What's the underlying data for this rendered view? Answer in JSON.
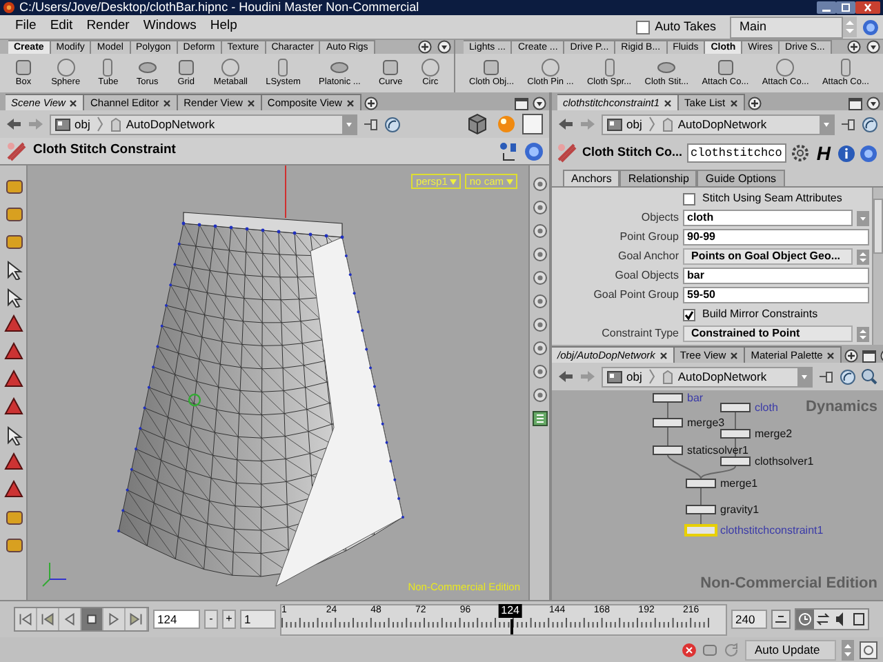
{
  "window": {
    "title": "C:/Users/Jove/Desktop/clothBar.hipnc - Houdini Master Non-Commercial"
  },
  "menu": [
    "File",
    "Edit",
    "Render",
    "Windows",
    "Help"
  ],
  "auto_takes": {
    "label": "Auto Takes",
    "checked": false
  },
  "take_menu": {
    "value": "Main"
  },
  "shelves": [
    {
      "tabs": [
        {
          "label": "Create",
          "selected": true
        },
        {
          "label": "Modify",
          "selected": false
        },
        {
          "label": "Model",
          "selected": false
        },
        {
          "label": "Polygon",
          "selected": false
        },
        {
          "label": "Deform",
          "selected": false
        },
        {
          "label": "Texture",
          "selected": false
        },
        {
          "label": "Character",
          "selected": false
        },
        {
          "label": "Auto Rigs",
          "selected": false
        }
      ],
      "tools": [
        "Box",
        "Sphere",
        "Tube",
        "Torus",
        "Grid",
        "Metaball",
        "LSystem",
        "Platonic ...",
        "Curve",
        "Circ"
      ]
    },
    {
      "tabs": [
        {
          "label": "Lights ...",
          "selected": false
        },
        {
          "label": "Create ...",
          "selected": false
        },
        {
          "label": "Drive P...",
          "selected": false
        },
        {
          "label": "Rigid B...",
          "selected": false
        },
        {
          "label": "Fluids",
          "selected": false
        },
        {
          "label": "Cloth",
          "selected": true
        },
        {
          "label": "Wires",
          "selected": false
        },
        {
          "label": "Drive S...",
          "selected": false
        }
      ],
      "tools": [
        "Cloth Obj...",
        "Cloth Pin ...",
        "Cloth Spr...",
        "Cloth Stit...",
        "Attach Co...",
        "Attach Co...",
        "Attach Co..."
      ]
    }
  ],
  "scene_pane": {
    "tabs": [
      {
        "label": "Scene View",
        "selected": true
      },
      {
        "label": "Channel Editor",
        "selected": false
      },
      {
        "label": "Render View",
        "selected": false
      },
      {
        "label": "Composite View",
        "selected": false
      }
    ],
    "path": [
      "obj",
      "AutoDopNetwork"
    ],
    "operation": "Cloth Stitch Constraint",
    "viewport": {
      "camera": "persp1",
      "lens": "no cam",
      "edition": "Non-Commercial Edition"
    }
  },
  "parameter_pane": {
    "tabs": [
      {
        "label": "clothstitchconstraint1",
        "selected": true
      },
      {
        "label": "Take List",
        "selected": false
      }
    ],
    "path": [
      "obj",
      "AutoDopNetwork"
    ],
    "node_type": "Cloth Stitch Co...",
    "node_name": "clothstitchco",
    "glyph": "H",
    "param_tabs": [
      {
        "label": "Anchors",
        "selected": true
      },
      {
        "label": "Relationship",
        "selected": false
      },
      {
        "label": "Guide Options",
        "selected": false
      }
    ],
    "params": [
      {
        "kind": "toggle",
        "label": "Stitch Using Seam Attributes",
        "checked": false
      },
      {
        "kind": "field_menu",
        "label": "Objects",
        "value": "cloth"
      },
      {
        "kind": "field",
        "label": "Point Group",
        "value": "90-99"
      },
      {
        "kind": "menu",
        "label": "Goal Anchor",
        "value": "Points on Goal Object Geo..."
      },
      {
        "kind": "field",
        "label": "Goal Objects",
        "value": "bar"
      },
      {
        "kind": "field",
        "label": "Goal Point Group",
        "value": "59-50"
      },
      {
        "kind": "toggle",
        "label": "Build Mirror Constraints",
        "checked": true
      },
      {
        "kind": "menu",
        "label": "Constraint Type",
        "value": "Constrained to Point"
      }
    ]
  },
  "network_pane": {
    "tabs": [
      {
        "label": "/obj/AutoDopNetwork",
        "selected": true
      },
      {
        "label": "Tree View",
        "selected": false
      },
      {
        "label": "Material Palette",
        "selected": false
      }
    ],
    "path": [
      "obj",
      "AutoDopNetwork"
    ],
    "context": "Dynamics",
    "edition": "Non-Commercial Edition",
    "nodes": [
      {
        "label": "bar",
        "color": "#3a3aa8",
        "selected": false
      },
      {
        "label": "cloth",
        "color": "#3a3aa8",
        "selected": false
      },
      {
        "label": "merge3",
        "color": "#111111",
        "selected": false
      },
      {
        "label": "merge2",
        "color": "#111111",
        "selected": false
      },
      {
        "label": "staticsolver1",
        "color": "#111111",
        "selected": false
      },
      {
        "label": "clothsolver1",
        "color": "#111111",
        "selected": false
      },
      {
        "label": "merge1",
        "color": "#111111",
        "selected": false
      },
      {
        "label": "gravity1",
        "color": "#111111",
        "selected": false
      },
      {
        "label": "clothstitchconstraint1",
        "color": "#3a3aa8",
        "selected": true
      }
    ]
  },
  "timeline": {
    "frame": "124",
    "minus": "-",
    "plus": "+",
    "start": "1",
    "end": "240",
    "ticks": [
      "1",
      "24",
      "48",
      "72",
      "96",
      "144",
      "168",
      "192",
      "216"
    ],
    "current": "124",
    "level": 0.515
  },
  "status_bar": {
    "update_mode": "Auto Update"
  }
}
